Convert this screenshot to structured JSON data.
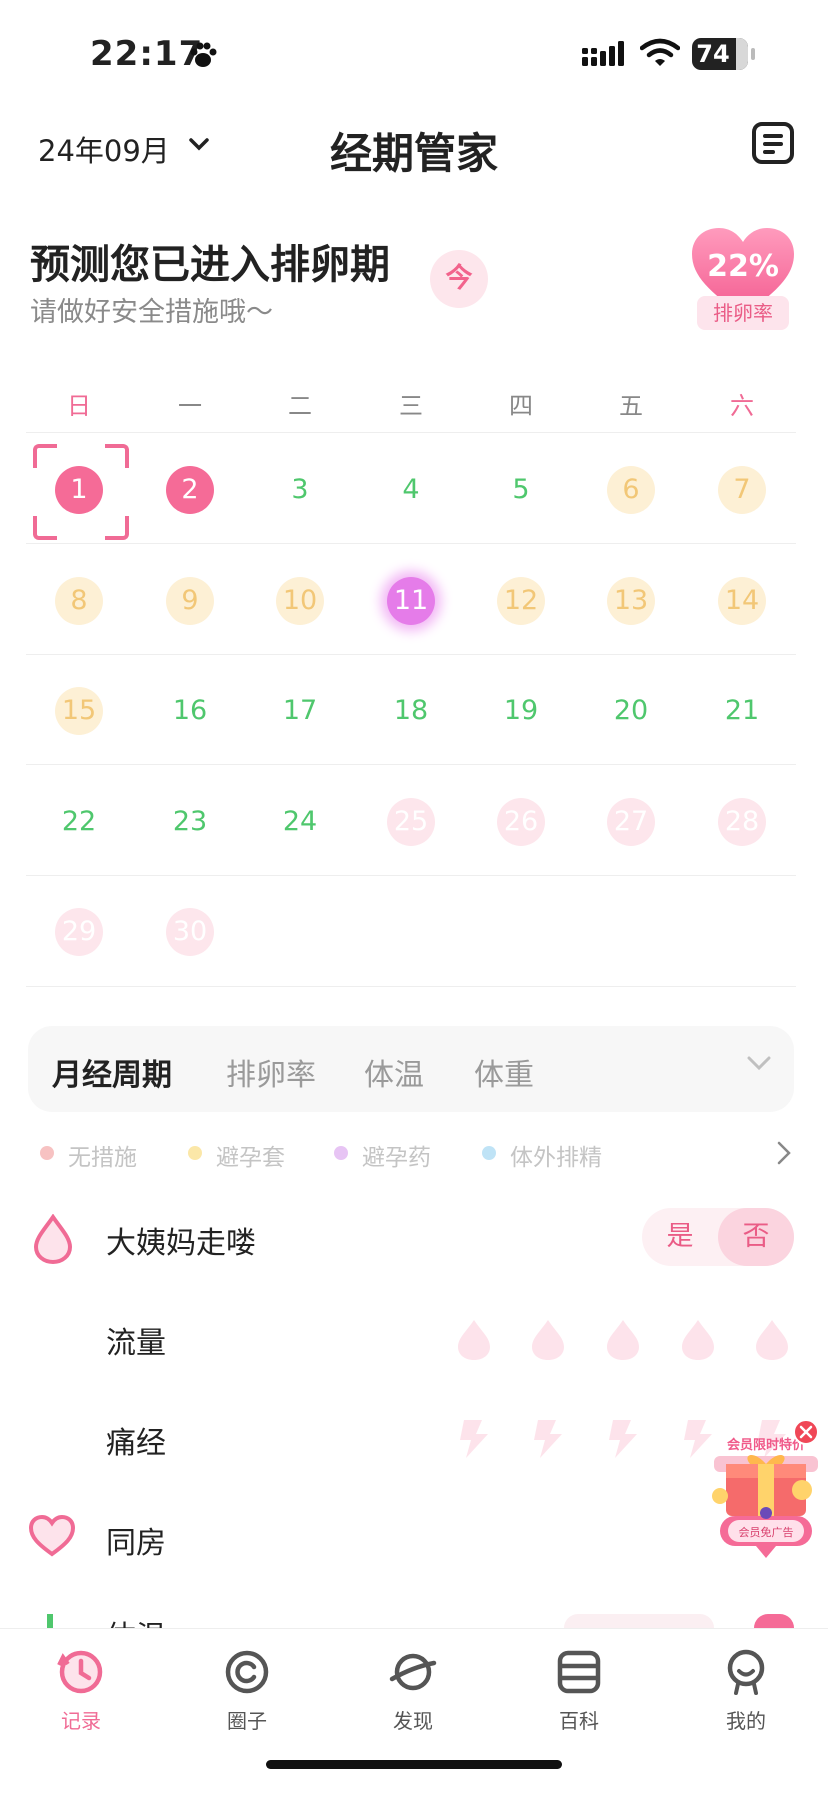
{
  "status_bar": {
    "time": "22:17",
    "battery": "74"
  },
  "header": {
    "month": "24年09月",
    "title": "经期管家"
  },
  "prediction": {
    "title": "预测您已进入排卵期",
    "subtitle": "请做好安全措施哦～",
    "today_label": "今",
    "ovulation_rate": "22%",
    "ovulation_rate_label": "排卵率"
  },
  "calendar": {
    "weekdays": [
      "日",
      "一",
      "二",
      "三",
      "四",
      "五",
      "六"
    ],
    "days": [
      {
        "n": "1",
        "state": "period",
        "selected": true
      },
      {
        "n": "2",
        "state": "period"
      },
      {
        "n": "3",
        "state": "normal"
      },
      {
        "n": "4",
        "state": "normal"
      },
      {
        "n": "5",
        "state": "normal"
      },
      {
        "n": "6",
        "state": "ovulation"
      },
      {
        "n": "7",
        "state": "ovulation"
      },
      {
        "n": "8",
        "state": "ovulation"
      },
      {
        "n": "9",
        "state": "ovulation"
      },
      {
        "n": "10",
        "state": "ovulation"
      },
      {
        "n": "11",
        "state": "ovulation-peak"
      },
      {
        "n": "12",
        "state": "ovulation"
      },
      {
        "n": "13",
        "state": "ovulation"
      },
      {
        "n": "14",
        "state": "ovulation"
      },
      {
        "n": "15",
        "state": "ovulation"
      },
      {
        "n": "16",
        "state": "normal"
      },
      {
        "n": "17",
        "state": "normal"
      },
      {
        "n": "18",
        "state": "normal"
      },
      {
        "n": "19",
        "state": "normal"
      },
      {
        "n": "20",
        "state": "normal"
      },
      {
        "n": "21",
        "state": "normal"
      },
      {
        "n": "22",
        "state": "normal"
      },
      {
        "n": "23",
        "state": "normal"
      },
      {
        "n": "24",
        "state": "normal"
      },
      {
        "n": "25",
        "state": "predicted-period"
      },
      {
        "n": "26",
        "state": "predicted-period"
      },
      {
        "n": "27",
        "state": "predicted-period"
      },
      {
        "n": "28",
        "state": "predicted-period"
      },
      {
        "n": "29",
        "state": "predicted-period"
      },
      {
        "n": "30",
        "state": "predicted-period"
      }
    ]
  },
  "tabs": [
    "月经周期",
    "排卵率",
    "体温",
    "体重"
  ],
  "legend": [
    {
      "label": "无措施",
      "color": "#f36b6b"
    },
    {
      "label": "避孕套",
      "color": "#f7c84a"
    },
    {
      "label": "避孕药",
      "color": "#c27ae8"
    },
    {
      "label": "体外排精",
      "color": "#56b8ea"
    }
  ],
  "records": {
    "period_end": "大姨妈走喽",
    "yes": "是",
    "no": "否",
    "flow": "流量",
    "cramps": "痛经",
    "intimacy": "同房",
    "temperature": "体温"
  },
  "ad": {
    "title": "会员限时特价",
    "button": "会员免广告"
  },
  "nav": [
    "记录",
    "圈子",
    "发现",
    "百科",
    "我的"
  ],
  "colors": {
    "accent": "#f06b95",
    "green": "#4fc76d",
    "ovulation": "#fdf0d5"
  }
}
